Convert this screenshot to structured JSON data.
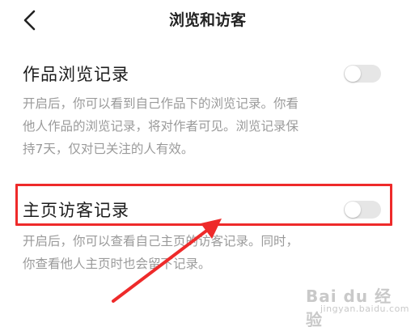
{
  "header": {
    "title": "浏览和访客",
    "back_icon": "chevron-left-icon"
  },
  "settings": [
    {
      "label": "作品浏览记录",
      "enabled": false,
      "description": [
        "开启后，你可以看到自己作品下的浏览记录。你看",
        "他人作品的浏览记录，将对作者可见。浏览记录保",
        "持7天，仅对已关注的人有效。"
      ]
    },
    {
      "label": "主页访客记录",
      "enabled": false,
      "description": [
        "开启后，你可以查看自己主页的访客记录。同时，",
        "你查看他人主页时也会留下记录。"
      ]
    }
  ],
  "annotation": {
    "highlight_color": "#ee2a2a",
    "arrow_color": "#ee2a2a"
  },
  "watermark": {
    "logo": "Bai du 经验",
    "url": "jingyan.baidu.com"
  },
  "colors": {
    "toggle_off": "#e6e6e6",
    "description_text": "#9a9a9a"
  }
}
